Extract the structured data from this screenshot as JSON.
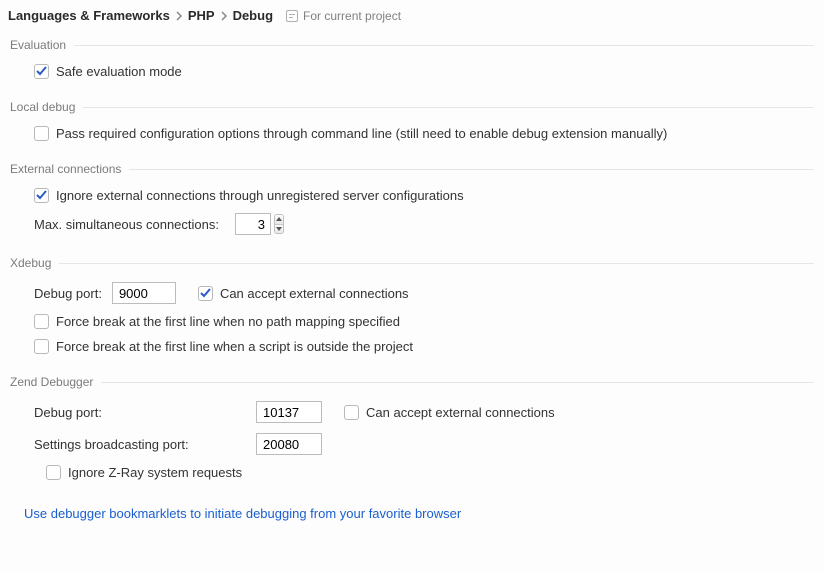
{
  "breadcrumb": {
    "item0": "Languages & Frameworks",
    "item1": "PHP",
    "item2": "Debug"
  },
  "scope_label": "For current project",
  "sections": {
    "evaluation": {
      "title": "Evaluation",
      "safe_mode_label": "Safe evaluation mode",
      "safe_mode_checked": true
    },
    "local_debug": {
      "title": "Local debug",
      "pass_opts_label": "Pass required configuration options through command line (still need to enable debug extension manually)",
      "pass_opts_checked": false
    },
    "external": {
      "title": "External connections",
      "ignore_unreg_label": "Ignore external connections through unregistered server configurations",
      "ignore_unreg_checked": true,
      "max_conn_label": "Max. simultaneous connections:",
      "max_conn_value": "3"
    },
    "xdebug": {
      "title": "Xdebug",
      "debug_port_label": "Debug port:",
      "debug_port_value": "9000",
      "accept_ext_label": "Can accept external connections",
      "accept_ext_checked": true,
      "force1_label": "Force break at the first line when no path mapping specified",
      "force1_checked": false,
      "force2_label": "Force break at the first line when a script is outside the project",
      "force2_checked": false
    },
    "zend": {
      "title": "Zend Debugger",
      "debug_port_label": "Debug port:",
      "debug_port_value": "10137",
      "accept_ext_label": "Can accept external connections",
      "accept_ext_checked": false,
      "broadcast_label": "Settings broadcasting port:",
      "broadcast_value": "20080",
      "ignore_zray_label": "Ignore Z-Ray system requests",
      "ignore_zray_checked": false
    }
  },
  "bookmarklet_link": "Use debugger bookmarklets to initiate debugging from your favorite browser"
}
